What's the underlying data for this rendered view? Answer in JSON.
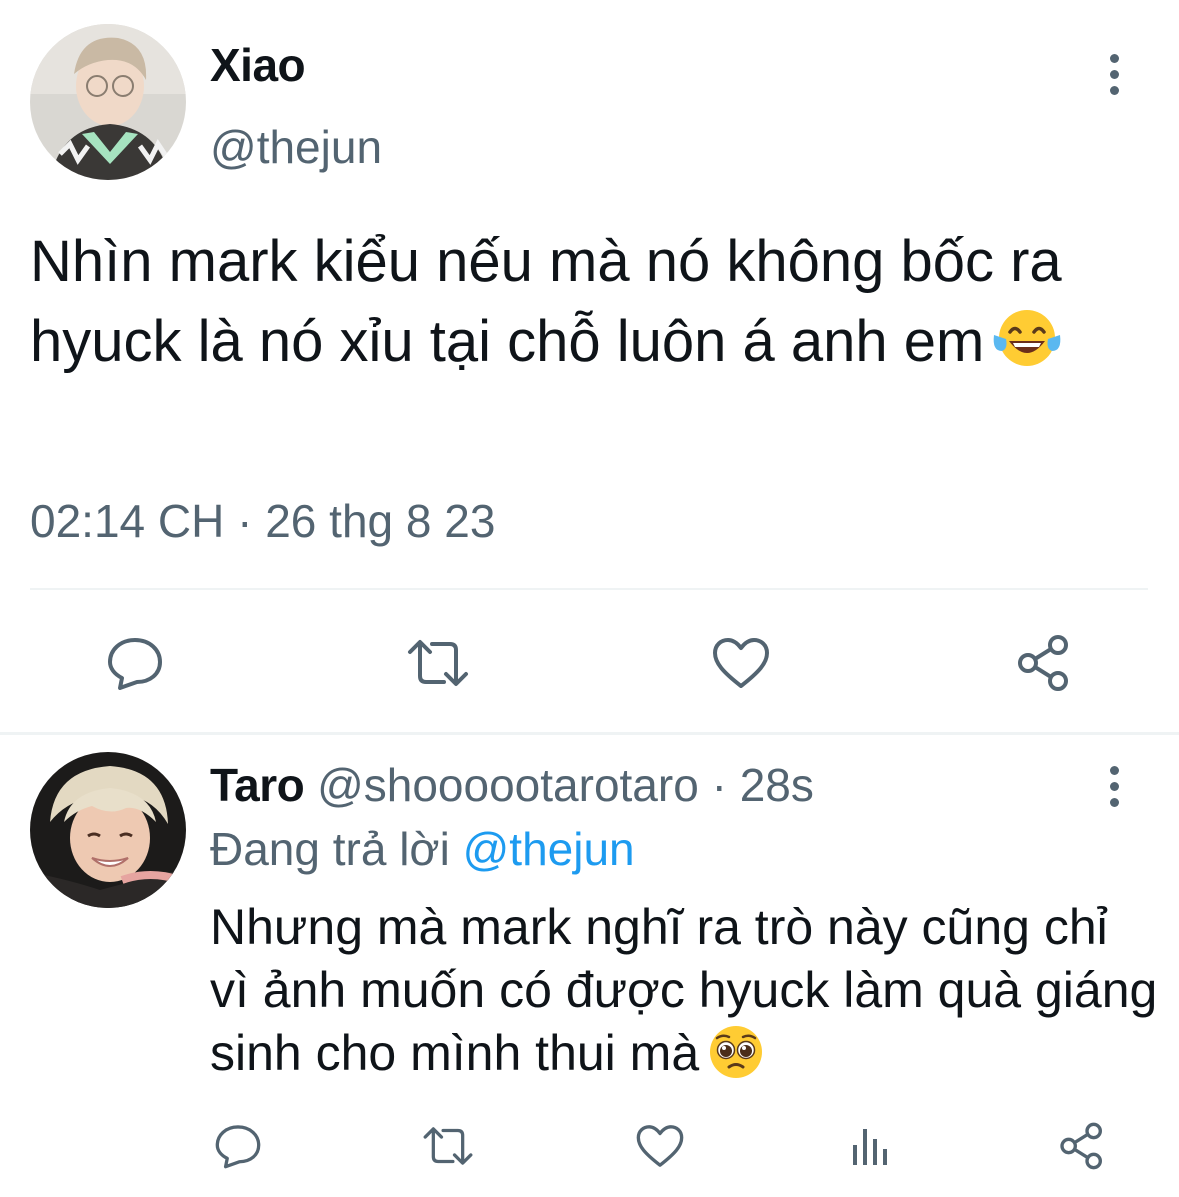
{
  "main_tweet": {
    "author_name": "Xiao",
    "author_handle": "@thejun",
    "text": "Nhìn mark kiểu nếu mà nó không bốc ra hyuck là nó xỉu tại chỗ luôn á anh em",
    "text_emoji": "face-with-tears-of-joy",
    "timestamp": "02:14 CH · 26 thg 8 23",
    "actions": [
      "reply-icon",
      "retweet-icon",
      "like-icon",
      "share-icon"
    ]
  },
  "reply_tweet": {
    "author_name": "Taro",
    "author_handle": "@shoooootarotaro",
    "separator": "·",
    "time_ago": "28s",
    "replying_label": "Đang trả lời",
    "replying_mention": "@thejun",
    "text": "Nhưng mà mark nghĩ ra trò này cũng chỉ vì ảnh muốn có được hyuck làm quà giáng sinh cho mình thui mà",
    "text_emoji": "pleading-face",
    "actions": [
      "reply-icon",
      "retweet-icon",
      "like-icon",
      "analytics-icon",
      "share-icon"
    ]
  },
  "colors": {
    "text_primary": "#0f1419",
    "text_secondary": "#536471",
    "link": "#1d9bf0",
    "divider": "#eff3f4"
  }
}
